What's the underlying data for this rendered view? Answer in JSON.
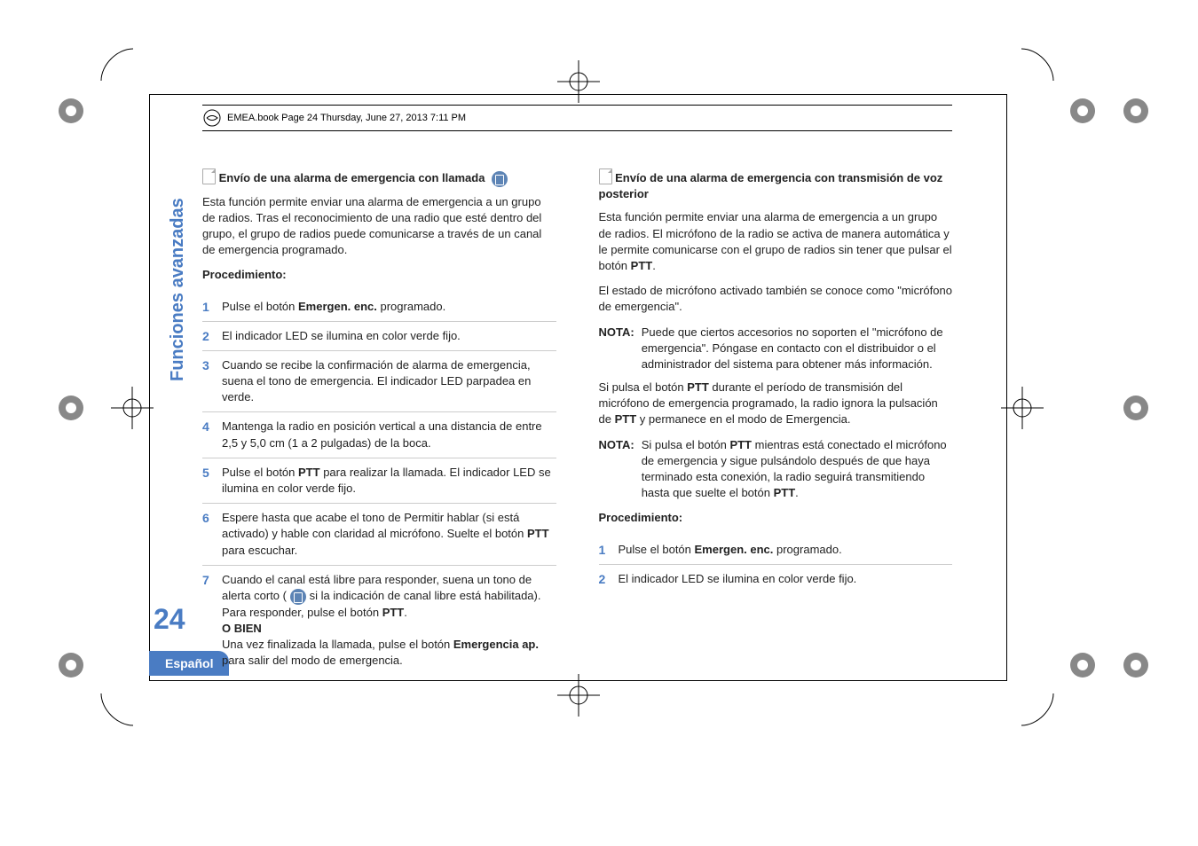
{
  "header": "EMEA.book  Page 24  Thursday, June 27, 2013  7:11 PM",
  "sidebar_text": "Funciones avanzadas",
  "page_number": "24",
  "language_tab": "Español",
  "left": {
    "heading": "Envío de una alarma de emergencia con llamada",
    "intro": "Esta función permite enviar una alarma de emergencia a un grupo de radios. Tras el reconocimiento de una radio que esté dentro del grupo, el grupo de radios puede comunicarse a través de un canal de emergencia programado.",
    "proc_label": "Procedimiento",
    "steps": {
      "s1a": "Pulse el botón ",
      "s1b": "Emergen. enc.",
      "s1c": " programado.",
      "s2": "El indicador LED se ilumina en color verde fijo.",
      "s3": "Cuando se recibe la confirmación de alarma de emergencia, suena el tono de emergencia. El indicador LED parpadea en verde.",
      "s4": "Mantenga la radio en posición vertical a una distancia de entre 2,5 y 5,0 cm (1 a 2 pulgadas) de la boca.",
      "s5a": "Pulse el botón ",
      "s5b": "PTT",
      "s5c": " para realizar la llamada. El indicador LED se ilumina en color verde fijo.",
      "s6a": "Espere hasta que acabe el tono de Permitir hablar (si está activado) y hable con claridad al micrófono. Suelte el botón ",
      "s6b": "PTT",
      "s6c": " para escuchar.",
      "s7a": "Cuando el canal está libre para responder, suena un tono de alerta corto (",
      "s7b": " si la indicación de canal libre está habilitada). Para responder, pulse el botón ",
      "s7c": "PTT",
      "s7d": ".",
      "s7_or": "O BIEN",
      "s7e": "Una vez finalizada la llamada, pulse el botón ",
      "s7f": "Emergencia ap.",
      "s7g": " para salir del modo de emergencia."
    }
  },
  "right": {
    "heading": "Envío de una alarma de emergencia con transmisión de voz posterior",
    "p1a": "Esta función permite enviar una alarma de emergencia a un grupo de radios. El micrófono de la radio se activa de manera automática y le permite comunicarse con el grupo de radios sin tener que pulsar el botón ",
    "p1b": "PTT",
    "p1c": ".",
    "p2": "El estado de micrófono activado también se conoce como \"micrófono de emergencia\".",
    "note1_label": "NOTA:",
    "note1_body": "Puede que ciertos accesorios no soporten el \"micrófono de emergencia\". Póngase en contacto con el distribuidor o el administrador del sistema para obtener más información.",
    "p3a": "Si pulsa el botón ",
    "p3b": "PTT",
    "p3c": " durante el período de transmisión del micrófono de emergencia programado, la radio ignora la pulsación de ",
    "p3d": "PTT",
    "p3e": " y permanece en el modo de Emergencia.",
    "note2_label": "NOTA:",
    "note2_body_a": " Si pulsa el botón ",
    "note2_body_b": "PTT",
    "note2_body_c": " mientras está conectado el micrófono de emergencia y sigue pulsándolo después de que haya terminado esta conexión, la radio seguirá transmitiendo hasta que suelte el botón ",
    "note2_body_d": "PTT",
    "note2_body_e": ".",
    "proc_label": "Procedimiento",
    "steps": {
      "s1a": "Pulse el botón ",
      "s1b": "Emergen. enc.",
      "s1c": " programado.",
      "s2": "El indicador LED se ilumina en color verde fijo."
    }
  }
}
